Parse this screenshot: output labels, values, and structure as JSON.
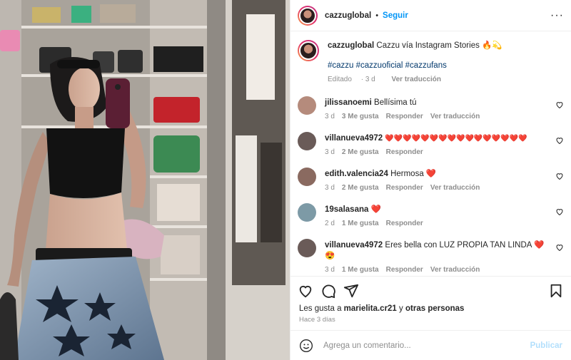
{
  "post": {
    "author": "cazzuglobal",
    "follow_label": "Seguir",
    "dot": "•",
    "more": "···",
    "caption_text": "Cazzu vía Instagram Stories 🔥💫",
    "hashtags": "#cazzu #cazzuoficial #cazzufans",
    "edited": "Editado",
    "caption_age": "3 d",
    "translate": "Ver traducción"
  },
  "comments": [
    {
      "user": "jilissanoemi",
      "text": "Bellísima tú",
      "age": "3 d",
      "likes": "3 Me gusta",
      "reply": "Responder",
      "translate": "Ver traducción",
      "color": "#b58b7c"
    },
    {
      "user": "villanueva4972",
      "text": "❤️❤️❤️❤️❤️❤️❤️❤️❤️❤️❤️❤️❤️❤️❤️❤️",
      "age": "3 d",
      "likes": "2 Me gusta",
      "reply": "Responder",
      "translate": "",
      "color": "#6a5b58"
    },
    {
      "user": "edith.valencia24",
      "text": "Hermosa ❤️",
      "age": "3 d",
      "likes": "2 Me gusta",
      "reply": "Responder",
      "translate": "Ver traducción",
      "color": "#8a6a60"
    },
    {
      "user": "19salasana",
      "text": "❤️",
      "age": "2 d",
      "likes": "1 Me gusta",
      "reply": "Responder",
      "translate": "",
      "color": "#7d9aa6"
    },
    {
      "user": "villanueva4972",
      "text": "Eres bella con LUZ PROPIA TAN LINDA ❤️😍",
      "age": "3 d",
      "likes": "1 Me gusta",
      "reply": "Responder",
      "translate": "Ver traducción",
      "color": "#6a5b58"
    }
  ],
  "likes": {
    "prefix": "Les gusta a",
    "user": "marielita.cr21",
    "connector": "y",
    "others": "otras personas",
    "age": "Hace 3 días"
  },
  "add_comment": {
    "placeholder": "Agrega un comentario...",
    "publish": "Publicar"
  },
  "icons": {
    "heart": "heart-icon",
    "comment": "comment-icon",
    "share": "share-icon",
    "save": "bookmark-icon",
    "emoji": "emoji-icon"
  }
}
